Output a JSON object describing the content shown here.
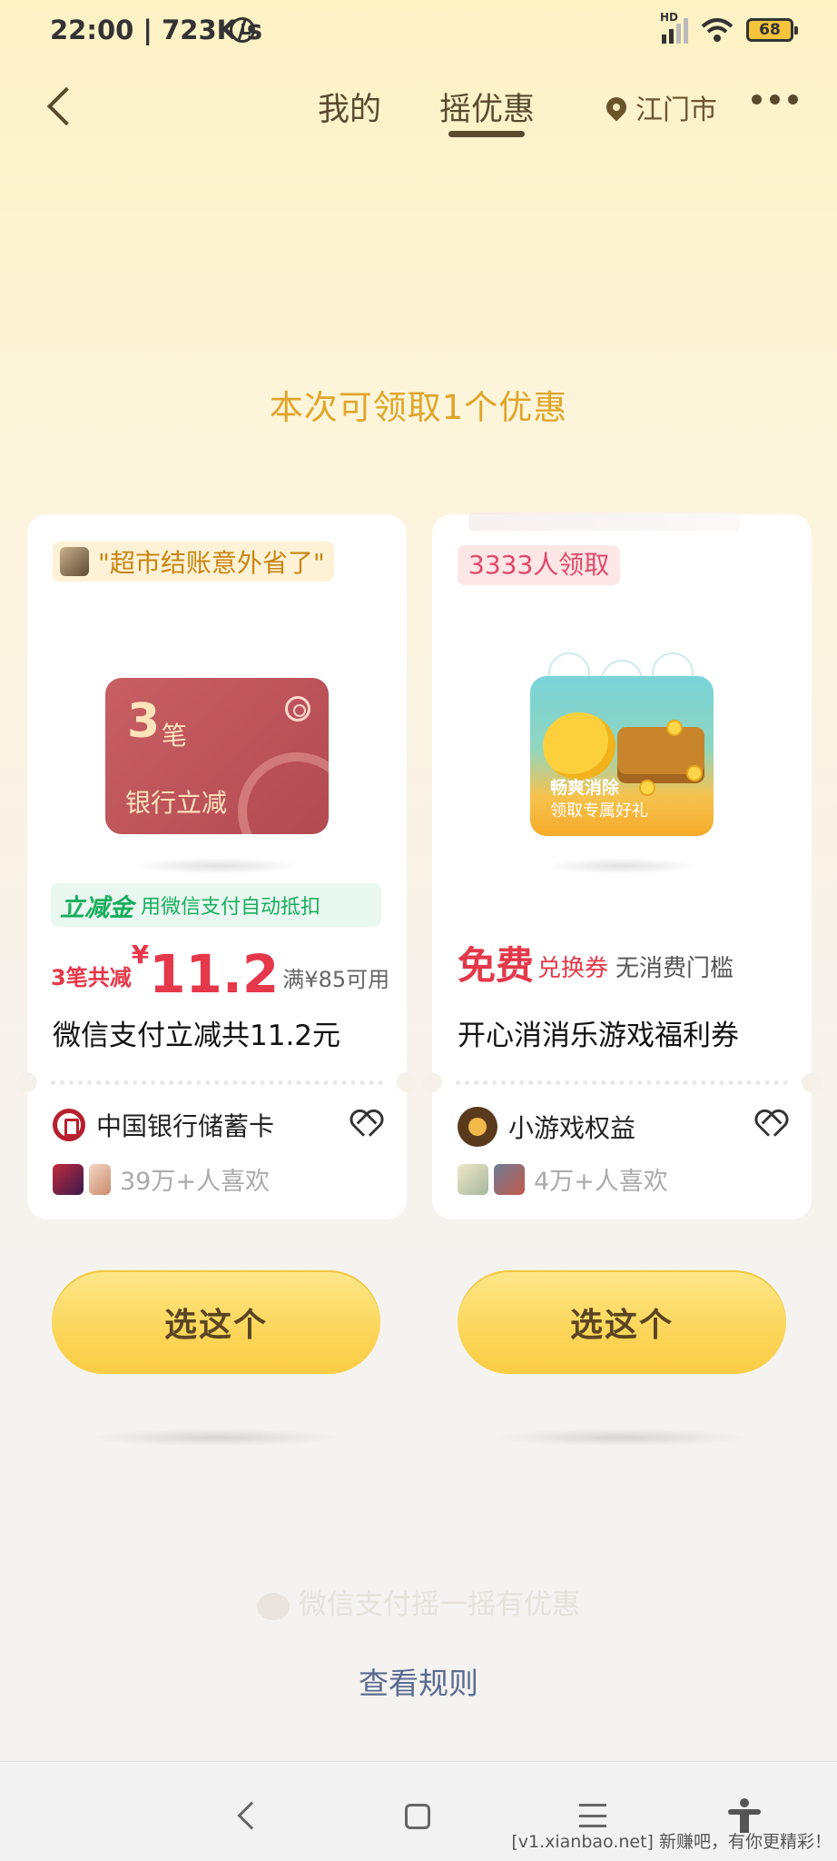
{
  "status_bar": {
    "time": "22:00 | 723K/s",
    "network": "HD",
    "battery": "68"
  },
  "nav": {
    "tabs": [
      {
        "label": "我的"
      },
      {
        "label": "摇优惠"
      }
    ],
    "active_tab": "摇优惠",
    "location": "江门市"
  },
  "headline": "本次可领取1个优惠",
  "cards": [
    {
      "badge": "\"超市结账意外省了\"",
      "visual": {
        "number": "3",
        "unit": "笔",
        "label": "银行立减"
      },
      "tag": {
        "strong": "立减金",
        "weak": "用微信支付自动抵扣"
      },
      "price": {
        "prefix": "3笔共减",
        "currency": "¥",
        "amount": "11.2",
        "condition": "满¥85可用"
      },
      "title": "微信支付立减共11.2元",
      "brand": "中国银行储蓄卡",
      "likes": "39万+人喜欢",
      "button": "选这个"
    },
    {
      "badge": "3333人领取",
      "visual": {
        "line1": "畅爽消除",
        "line2": "领取专属好礼"
      },
      "offer": {
        "big": "免费",
        "mid": "兑换券",
        "small": "无消费门槛"
      },
      "title": "开心消消乐游戏福利券",
      "brand": "小游戏权益",
      "likes": "4万+人喜欢",
      "button": "选这个"
    }
  ],
  "footer": {
    "slogan": "微信支付摇一摇有优惠",
    "rules_link": "查看规则"
  },
  "watermark": "[v1.xianbao.net] 新赚吧，有你更精彩！",
  "colors": {
    "accent_gold": "#e0a52a",
    "price_red": "#e5384a",
    "tag_green": "#1aad5f",
    "button_yellow": "#fcd75c",
    "link_blue": "#5a6b8e"
  }
}
